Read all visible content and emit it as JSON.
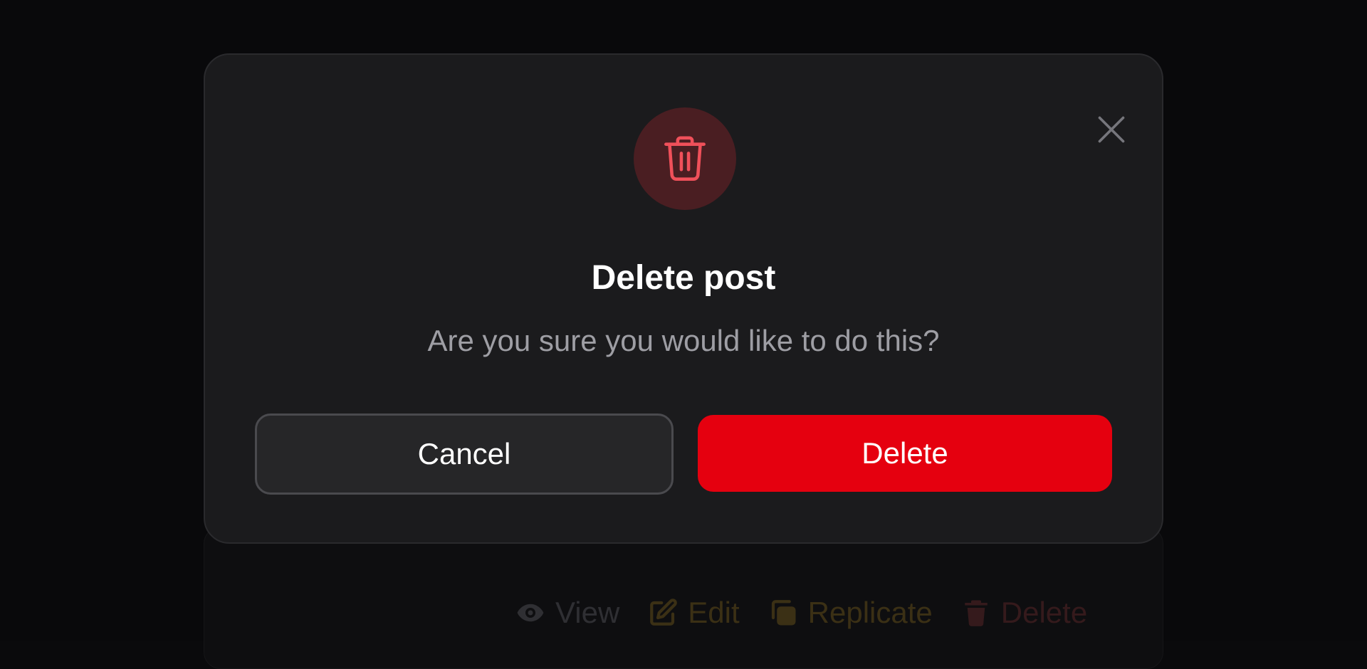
{
  "background": {
    "actions": [
      {
        "label": "View",
        "icon": "eye-icon",
        "color": "#2f2f33"
      },
      {
        "label": "Edit",
        "icon": "pencil-square-icon",
        "color": "#3b3015"
      },
      {
        "label": "Replicate",
        "icon": "copy-icon",
        "color": "#3b3015"
      },
      {
        "label": "Delete",
        "icon": "trash-icon",
        "color": "#351a1c"
      }
    ]
  },
  "dialog": {
    "icon": "trash-icon",
    "title": "Delete post",
    "message": "Are you sure you would like to do this?",
    "close_icon": "close-icon",
    "cancel_label": "Cancel",
    "confirm_label": "Delete",
    "colors": {
      "danger": "#e5000f",
      "icon_tint": "#f0505a",
      "icon_bg": "#4a1e22"
    }
  }
}
